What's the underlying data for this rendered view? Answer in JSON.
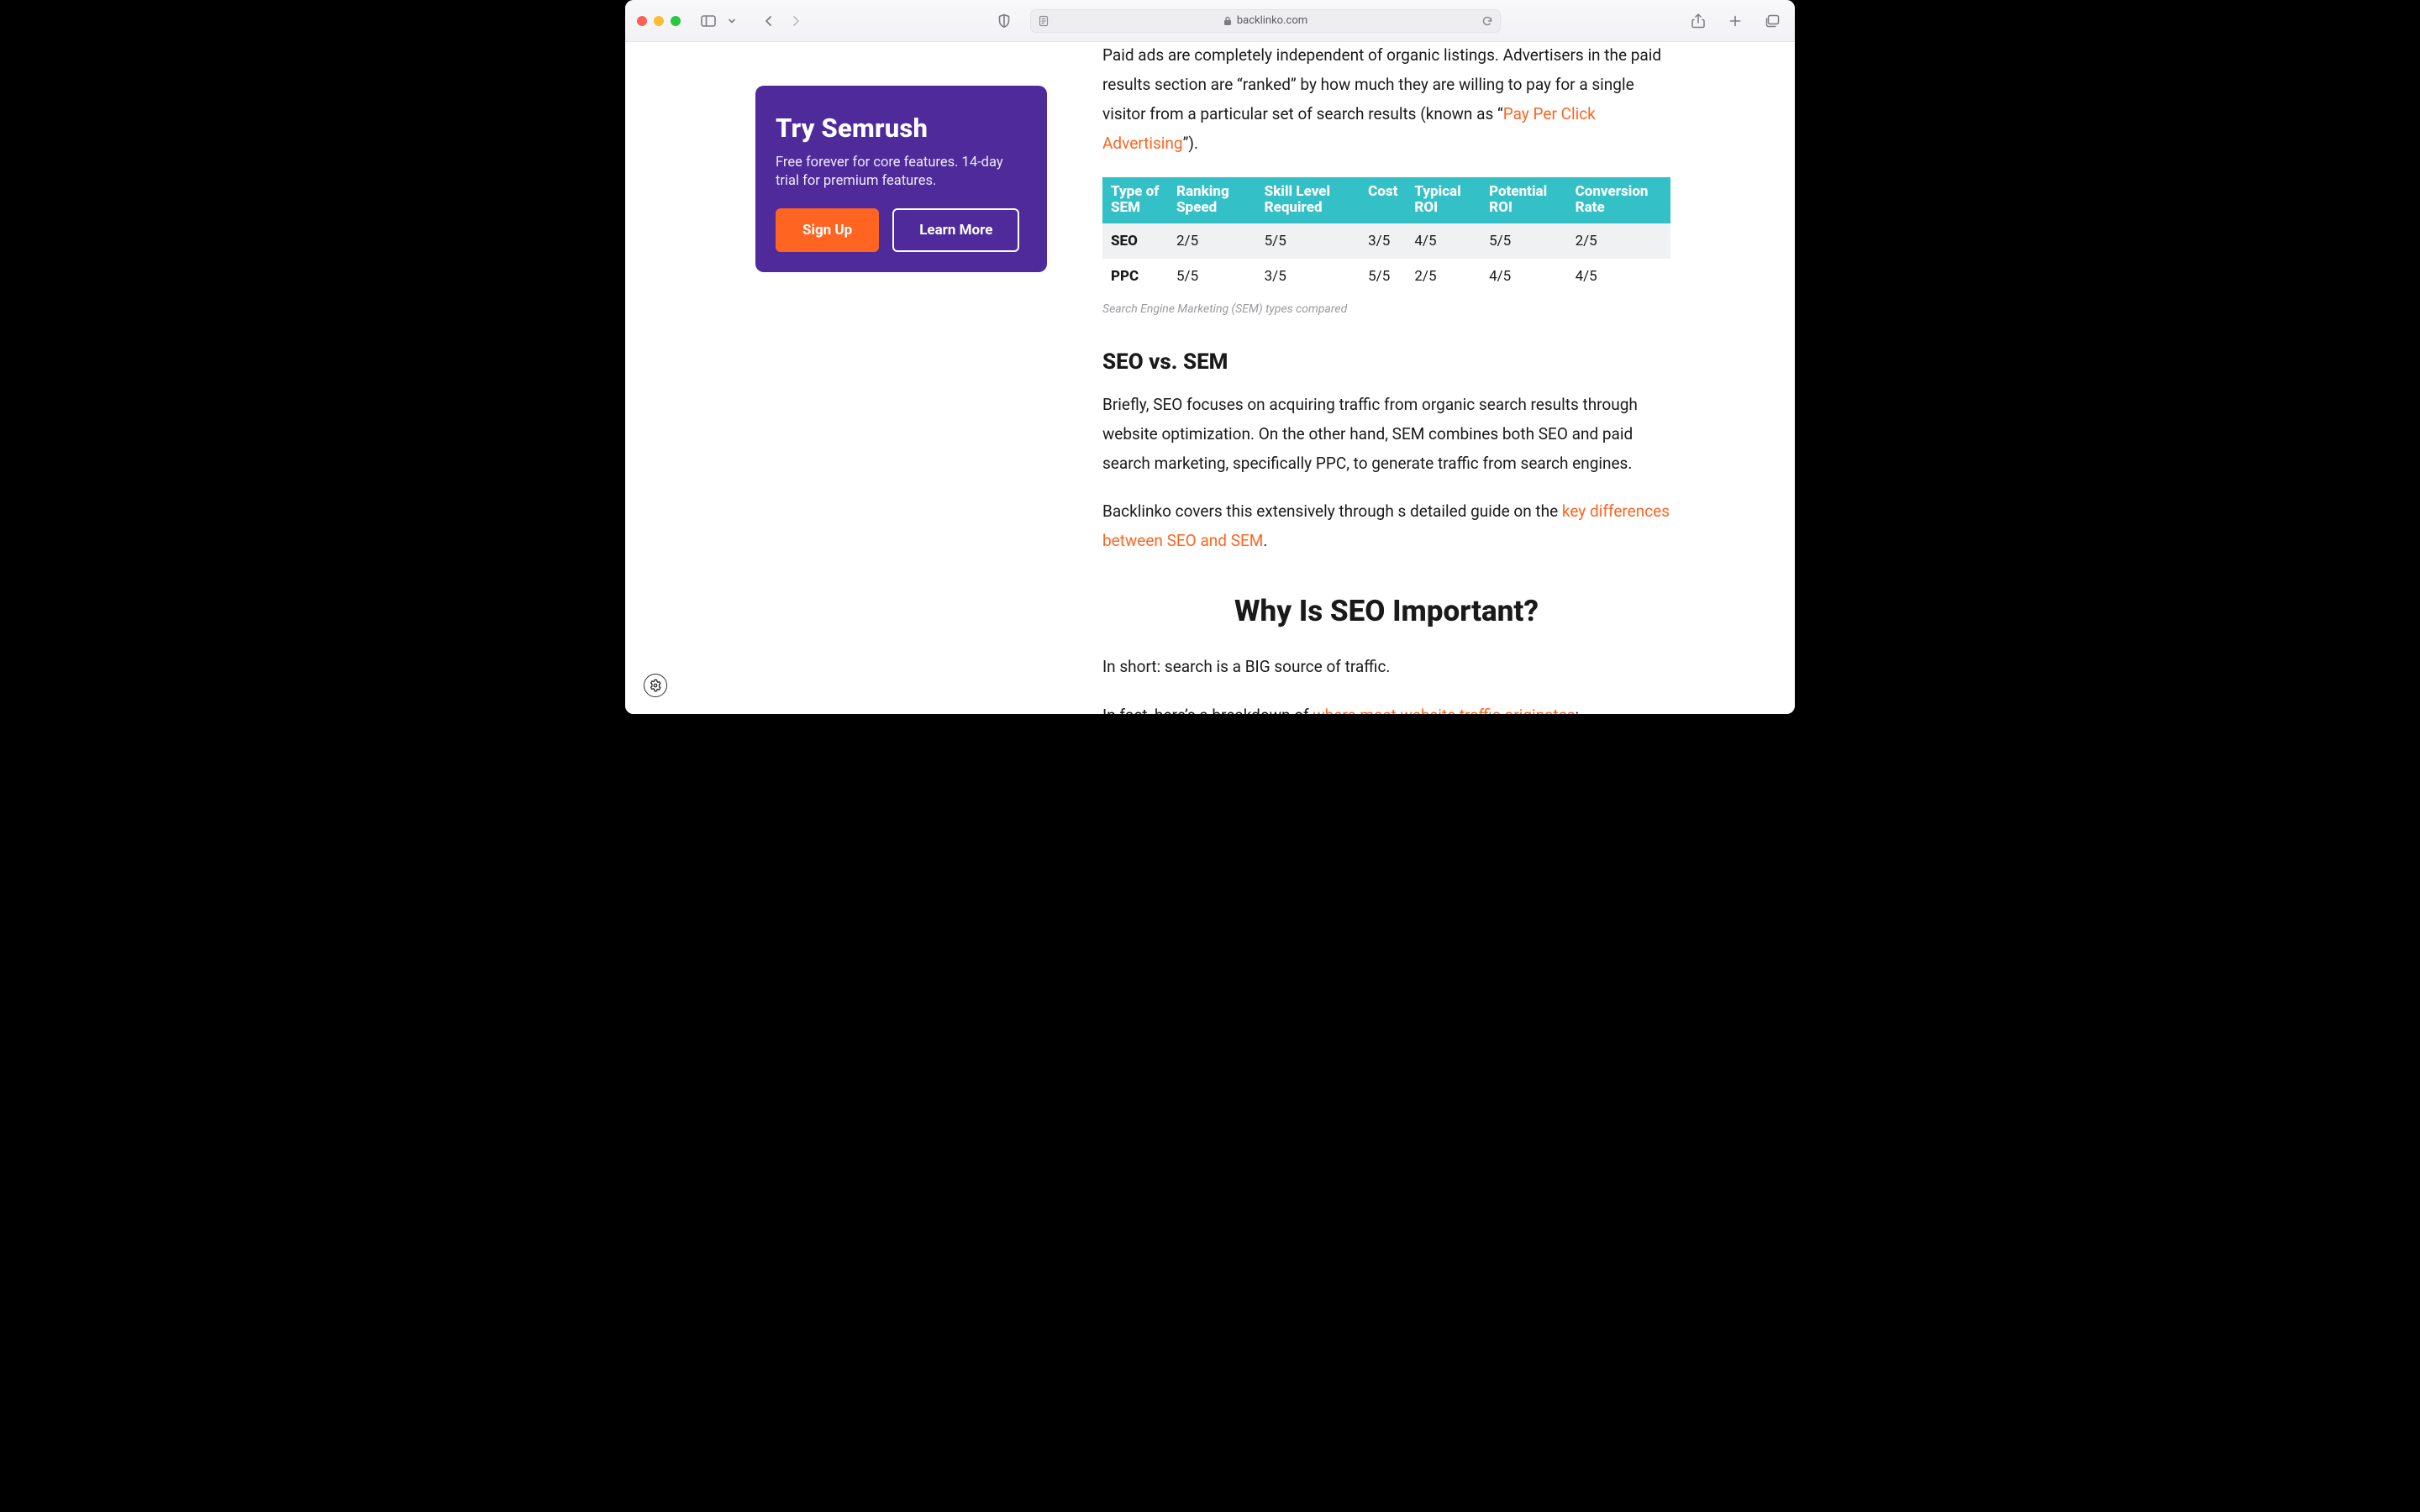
{
  "browser": {
    "domain": "backlinko.com"
  },
  "sidebar": {
    "title": "Try Semrush",
    "subtitle": "Free forever for core features. 14-day trial for premium features.",
    "signup_label": "Sign Up",
    "learn_more_label": "Learn More"
  },
  "article": {
    "para1_pre": "Paid ads are completely independent of organic listings. Advertisers in the paid results section are “ranked” by how much they are willing to pay for a single visitor from a particular set of search results (known as “",
    "para1_link": "Pay Per Click Advertising",
    "para1_post": "”).",
    "caption": "Search Engine Marketing (SEM) types compared",
    "h3_seo_vs_sem": "SEO vs. SEM",
    "para_seo_vs_sem": "Briefly, SEO focuses on acquiring traffic from organic search results through website optimization. On the other hand, SEM combines both SEO and paid search marketing, specifically PPC, to generate traffic from search engines.",
    "para_backlinko_pre": "Backlinko covers this extensively through s detailed guide on the ",
    "para_backlinko_link": "key differences between SEO and SEM",
    "para_backlinko_post": ".",
    "h2_why_seo": "Why Is SEO Important?",
    "para_big_source": "In short: search is a BIG source of traffic.",
    "para_breakdown_pre": "In fact, here’s a breakdown of ",
    "para_breakdown_link": "where most website traffic originates",
    "para_breakdown_post": ":"
  },
  "table": {
    "headers": [
      "Type of SEM",
      "Ranking Speed",
      "Skill Level Required",
      "Cost",
      "Typical ROI",
      "Potential ROI",
      "Conversion Rate"
    ],
    "rows": [
      {
        "name": "SEO",
        "values": [
          "2/5",
          "5/5",
          "3/5",
          "4/5",
          "5/5",
          "2/5"
        ]
      },
      {
        "name": "PPC",
        "values": [
          "5/5",
          "3/5",
          "5/5",
          "2/5",
          "4/5",
          "4/5"
        ]
      }
    ]
  },
  "chart_data": {
    "type": "table",
    "title": "Search Engine Marketing (SEM) types compared",
    "columns": [
      "Type of SEM",
      "Ranking Speed",
      "Skill Level Required",
      "Cost",
      "Typical ROI",
      "Potential ROI",
      "Conversion Rate"
    ],
    "rows": [
      {
        "Type of SEM": "SEO",
        "Ranking Speed": "2/5",
        "Skill Level Required": "5/5",
        "Cost": "3/5",
        "Typical ROI": "4/5",
        "Potential ROI": "5/5",
        "Conversion Rate": "2/5"
      },
      {
        "Type of SEM": "PPC",
        "Ranking Speed": "5/5",
        "Skill Level Required": "3/5",
        "Cost": "5/5",
        "Typical ROI": "2/5",
        "Potential ROI": "4/5",
        "Conversion Rate": "4/5"
      }
    ]
  }
}
